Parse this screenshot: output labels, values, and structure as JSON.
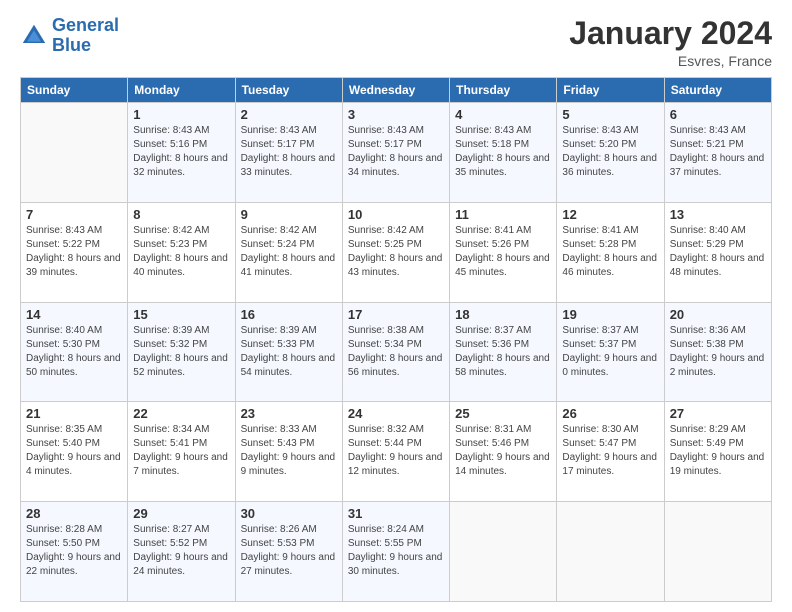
{
  "header": {
    "logo_line1": "General",
    "logo_line2": "Blue",
    "month": "January 2024",
    "location": "Esvres, France"
  },
  "weekdays": [
    "Sunday",
    "Monday",
    "Tuesday",
    "Wednesday",
    "Thursday",
    "Friday",
    "Saturday"
  ],
  "weeks": [
    [
      {
        "day": "",
        "sunrise": "",
        "sunset": "",
        "daylight": "",
        "empty": true
      },
      {
        "day": "1",
        "sunrise": "Sunrise: 8:43 AM",
        "sunset": "Sunset: 5:16 PM",
        "daylight": "Daylight: 8 hours and 32 minutes."
      },
      {
        "day": "2",
        "sunrise": "Sunrise: 8:43 AM",
        "sunset": "Sunset: 5:17 PM",
        "daylight": "Daylight: 8 hours and 33 minutes."
      },
      {
        "day": "3",
        "sunrise": "Sunrise: 8:43 AM",
        "sunset": "Sunset: 5:17 PM",
        "daylight": "Daylight: 8 hours and 34 minutes."
      },
      {
        "day": "4",
        "sunrise": "Sunrise: 8:43 AM",
        "sunset": "Sunset: 5:18 PM",
        "daylight": "Daylight: 8 hours and 35 minutes."
      },
      {
        "day": "5",
        "sunrise": "Sunrise: 8:43 AM",
        "sunset": "Sunset: 5:20 PM",
        "daylight": "Daylight: 8 hours and 36 minutes."
      },
      {
        "day": "6",
        "sunrise": "Sunrise: 8:43 AM",
        "sunset": "Sunset: 5:21 PM",
        "daylight": "Daylight: 8 hours and 37 minutes."
      }
    ],
    [
      {
        "day": "7",
        "sunrise": "Sunrise: 8:43 AM",
        "sunset": "Sunset: 5:22 PM",
        "daylight": "Daylight: 8 hours and 39 minutes."
      },
      {
        "day": "8",
        "sunrise": "Sunrise: 8:42 AM",
        "sunset": "Sunset: 5:23 PM",
        "daylight": "Daylight: 8 hours and 40 minutes."
      },
      {
        "day": "9",
        "sunrise": "Sunrise: 8:42 AM",
        "sunset": "Sunset: 5:24 PM",
        "daylight": "Daylight: 8 hours and 41 minutes."
      },
      {
        "day": "10",
        "sunrise": "Sunrise: 8:42 AM",
        "sunset": "Sunset: 5:25 PM",
        "daylight": "Daylight: 8 hours and 43 minutes."
      },
      {
        "day": "11",
        "sunrise": "Sunrise: 8:41 AM",
        "sunset": "Sunset: 5:26 PM",
        "daylight": "Daylight: 8 hours and 45 minutes."
      },
      {
        "day": "12",
        "sunrise": "Sunrise: 8:41 AM",
        "sunset": "Sunset: 5:28 PM",
        "daylight": "Daylight: 8 hours and 46 minutes."
      },
      {
        "day": "13",
        "sunrise": "Sunrise: 8:40 AM",
        "sunset": "Sunset: 5:29 PM",
        "daylight": "Daylight: 8 hours and 48 minutes."
      }
    ],
    [
      {
        "day": "14",
        "sunrise": "Sunrise: 8:40 AM",
        "sunset": "Sunset: 5:30 PM",
        "daylight": "Daylight: 8 hours and 50 minutes."
      },
      {
        "day": "15",
        "sunrise": "Sunrise: 8:39 AM",
        "sunset": "Sunset: 5:32 PM",
        "daylight": "Daylight: 8 hours and 52 minutes."
      },
      {
        "day": "16",
        "sunrise": "Sunrise: 8:39 AM",
        "sunset": "Sunset: 5:33 PM",
        "daylight": "Daylight: 8 hours and 54 minutes."
      },
      {
        "day": "17",
        "sunrise": "Sunrise: 8:38 AM",
        "sunset": "Sunset: 5:34 PM",
        "daylight": "Daylight: 8 hours and 56 minutes."
      },
      {
        "day": "18",
        "sunrise": "Sunrise: 8:37 AM",
        "sunset": "Sunset: 5:36 PM",
        "daylight": "Daylight: 8 hours and 58 minutes."
      },
      {
        "day": "19",
        "sunrise": "Sunrise: 8:37 AM",
        "sunset": "Sunset: 5:37 PM",
        "daylight": "Daylight: 9 hours and 0 minutes."
      },
      {
        "day": "20",
        "sunrise": "Sunrise: 8:36 AM",
        "sunset": "Sunset: 5:38 PM",
        "daylight": "Daylight: 9 hours and 2 minutes."
      }
    ],
    [
      {
        "day": "21",
        "sunrise": "Sunrise: 8:35 AM",
        "sunset": "Sunset: 5:40 PM",
        "daylight": "Daylight: 9 hours and 4 minutes."
      },
      {
        "day": "22",
        "sunrise": "Sunrise: 8:34 AM",
        "sunset": "Sunset: 5:41 PM",
        "daylight": "Daylight: 9 hours and 7 minutes."
      },
      {
        "day": "23",
        "sunrise": "Sunrise: 8:33 AM",
        "sunset": "Sunset: 5:43 PM",
        "daylight": "Daylight: 9 hours and 9 minutes."
      },
      {
        "day": "24",
        "sunrise": "Sunrise: 8:32 AM",
        "sunset": "Sunset: 5:44 PM",
        "daylight": "Daylight: 9 hours and 12 minutes."
      },
      {
        "day": "25",
        "sunrise": "Sunrise: 8:31 AM",
        "sunset": "Sunset: 5:46 PM",
        "daylight": "Daylight: 9 hours and 14 minutes."
      },
      {
        "day": "26",
        "sunrise": "Sunrise: 8:30 AM",
        "sunset": "Sunset: 5:47 PM",
        "daylight": "Daylight: 9 hours and 17 minutes."
      },
      {
        "day": "27",
        "sunrise": "Sunrise: 8:29 AM",
        "sunset": "Sunset: 5:49 PM",
        "daylight": "Daylight: 9 hours and 19 minutes."
      }
    ],
    [
      {
        "day": "28",
        "sunrise": "Sunrise: 8:28 AM",
        "sunset": "Sunset: 5:50 PM",
        "daylight": "Daylight: 9 hours and 22 minutes."
      },
      {
        "day": "29",
        "sunrise": "Sunrise: 8:27 AM",
        "sunset": "Sunset: 5:52 PM",
        "daylight": "Daylight: 9 hours and 24 minutes."
      },
      {
        "day": "30",
        "sunrise": "Sunrise: 8:26 AM",
        "sunset": "Sunset: 5:53 PM",
        "daylight": "Daylight: 9 hours and 27 minutes."
      },
      {
        "day": "31",
        "sunrise": "Sunrise: 8:24 AM",
        "sunset": "Sunset: 5:55 PM",
        "daylight": "Daylight: 9 hours and 30 minutes."
      },
      {
        "day": "",
        "sunrise": "",
        "sunset": "",
        "daylight": "",
        "empty": true
      },
      {
        "day": "",
        "sunrise": "",
        "sunset": "",
        "daylight": "",
        "empty": true
      },
      {
        "day": "",
        "sunrise": "",
        "sunset": "",
        "daylight": "",
        "empty": true
      }
    ]
  ]
}
